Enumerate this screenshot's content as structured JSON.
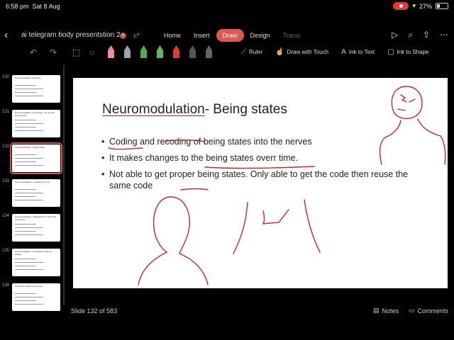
{
  "status_bar": {
    "time": "6:58 pm",
    "date": "Sat 8 Aug",
    "battery": "27%",
    "battery_level": 0.27,
    "icons": [
      "screen-record-icon",
      "wifi-icon",
      "battery-icon"
    ]
  },
  "title_bar": {
    "document_title": "ai telegram body presentstion 2",
    "tabs": [
      "Home",
      "Insert",
      "Draw",
      "Design",
      "Transi"
    ],
    "active_tab": "Draw",
    "icons": [
      "back-chevron-icon",
      "sync-badge-icon",
      "share-icon",
      "play-icon",
      "search-icon",
      "share-upload-icon",
      "more-icon"
    ]
  },
  "toolbar": {
    "tool_icons": [
      "undo-icon",
      "redo-icon",
      "lasso-select-icon",
      "lasso-rect-icon",
      "eraser-icon"
    ],
    "pens": [
      {
        "name": "pen-pink",
        "color": "#f08aa8"
      },
      {
        "name": "pen-gray",
        "color": "#9aa4b0"
      },
      {
        "name": "pen-green",
        "color": "#4caf50"
      },
      {
        "name": "pen-green-2",
        "color": "#5fb860"
      },
      {
        "name": "pen-red",
        "color": "#e53935"
      },
      {
        "name": "pen-dark",
        "color": "#555555"
      },
      {
        "name": "pen-dark-2",
        "color": "#666666"
      }
    ],
    "ruler_label": "Ruler",
    "draw_with_touch_label": "Draw with Touch",
    "ink_to_text_label": "Ink to Text",
    "ink_to_shape_label": "Ink to Shape"
  },
  "thumbnails": [
    {
      "number": "130",
      "title": "Neuromodulation and Body"
    },
    {
      "number": "131",
      "title": "Neuromodulation: psychology, nerves and being states"
    },
    {
      "number": "132",
      "title": "Neuromodulation - Being states",
      "selected": true
    },
    {
      "number": "133",
      "title": "Neuro modulation: modulation of one"
    },
    {
      "number": "134",
      "title": "Neuromodulation - Manipulation of personal operations"
    },
    {
      "number": "135",
      "title": "Neuromodulation: Controlling bodily by feeling"
    },
    {
      "number": "136",
      "title": "Advanced engineering of one"
    }
  ],
  "slide": {
    "title_underlined": "Neuromodulation",
    "title_rest": "- Being states",
    "bullets": [
      "Coding and recoding of being states into the nerves",
      "It makes changes to the being states overr time.",
      "Not able to get proper being states. Only able to get the code then reuse the same code"
    ],
    "ink_color": "#c62828"
  },
  "bottom_bar": {
    "slide_counter": "Slide 132 of 583",
    "notes_label": "Notes",
    "comments_label": "Comments"
  }
}
